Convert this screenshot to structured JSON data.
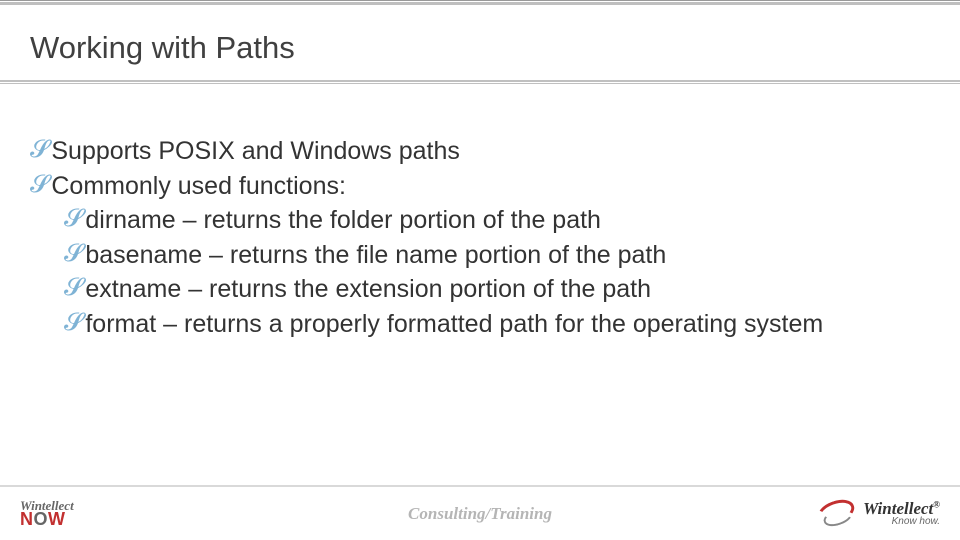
{
  "slide": {
    "title": "Working with Paths",
    "bullets": [
      {
        "text": "Supports POSIX and Windows paths",
        "level": 0
      },
      {
        "text": "Commonly used functions:",
        "level": 0
      },
      {
        "text": "dirname – returns the folder portion of the path",
        "level": 1
      },
      {
        "text": "basename – returns the file name portion of the path",
        "level": 1
      },
      {
        "text": "extname – returns the extension portion of the path",
        "level": 1
      },
      {
        "text": "format – returns a properly formatted path for the operating system",
        "level": 1
      }
    ]
  },
  "footer": {
    "center_text": "Consulting/Training",
    "logo_left": {
      "top": "Wintellect",
      "bottom": "NOW"
    },
    "logo_right": {
      "name": "Wintellect",
      "reg": "®",
      "tagline": "Know how."
    }
  }
}
